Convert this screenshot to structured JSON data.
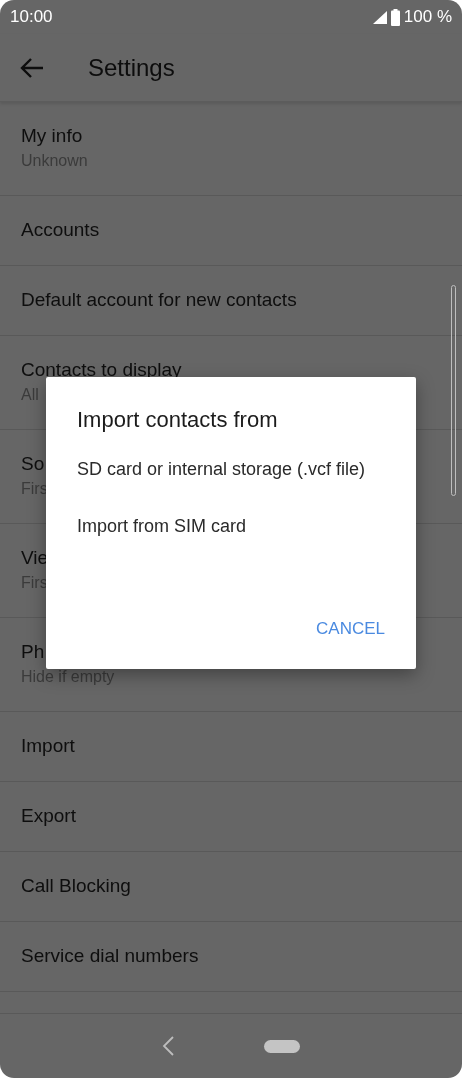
{
  "status_bar": {
    "time": "10:00",
    "battery": "100 %"
  },
  "app_bar": {
    "title": "Settings"
  },
  "settings": [
    {
      "title": "My info",
      "subtitle": "Unknown"
    },
    {
      "title": "Accounts"
    },
    {
      "title": "Default account for new contacts"
    },
    {
      "title": "Contacts to display",
      "subtitle": "All"
    },
    {
      "title": "So",
      "subtitle": "Firs"
    },
    {
      "title": "Vie",
      "subtitle": "Firs"
    },
    {
      "title": "Ph",
      "subtitle": "Hide if empty"
    },
    {
      "title": "Import"
    },
    {
      "title": "Export"
    },
    {
      "title": "Call Blocking"
    },
    {
      "title": "Service dial numbers"
    }
  ],
  "dialog": {
    "title": "Import contacts from",
    "options": [
      "SD card or internal storage (.vcf file)",
      "Import from SIM card"
    ],
    "buttons": [
      "CANCEL"
    ]
  }
}
